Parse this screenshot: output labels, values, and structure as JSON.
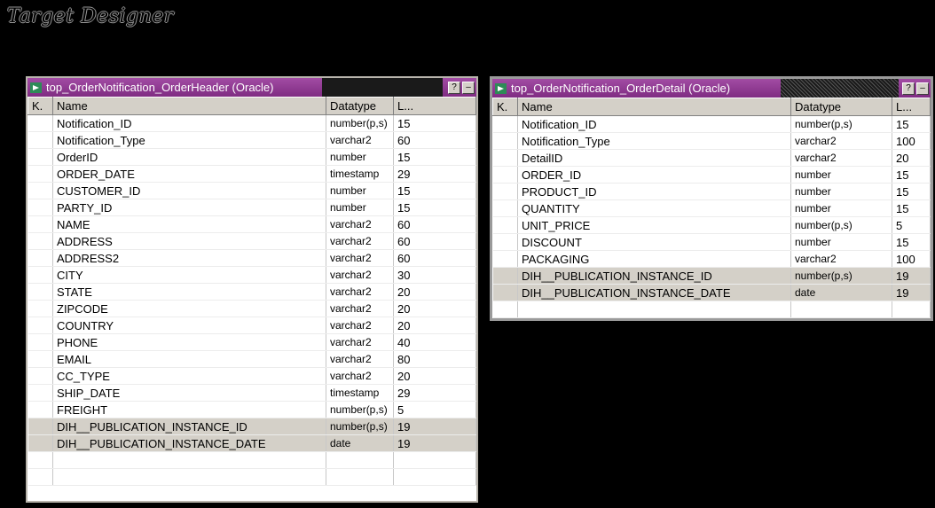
{
  "app": {
    "title": "Target Designer"
  },
  "tables": [
    {
      "title": "top_OrderNotification_OrderHeader (Oracle)",
      "columns": {
        "key": "K.",
        "name": "Name",
        "datatype": "Datatype",
        "length": "L..."
      },
      "rows": [
        {
          "name": "Notification_ID",
          "datatype": "number(p,s)",
          "length": "15"
        },
        {
          "name": "Notification_Type",
          "datatype": "varchar2",
          "length": "60"
        },
        {
          "name": "OrderID",
          "datatype": "number",
          "length": "15"
        },
        {
          "name": "ORDER_DATE",
          "datatype": "timestamp",
          "length": "29"
        },
        {
          "name": "CUSTOMER_ID",
          "datatype": "number",
          "length": "15"
        },
        {
          "name": "PARTY_ID",
          "datatype": "number",
          "length": "15"
        },
        {
          "name": "NAME",
          "datatype": "varchar2",
          "length": "60"
        },
        {
          "name": "ADDRESS",
          "datatype": "varchar2",
          "length": "60"
        },
        {
          "name": "ADDRESS2",
          "datatype": "varchar2",
          "length": "60"
        },
        {
          "name": "CITY",
          "datatype": "varchar2",
          "length": "30"
        },
        {
          "name": "STATE",
          "datatype": "varchar2",
          "length": "20"
        },
        {
          "name": "ZIPCODE",
          "datatype": "varchar2",
          "length": "20"
        },
        {
          "name": "COUNTRY",
          "datatype": "varchar2",
          "length": "20"
        },
        {
          "name": "PHONE",
          "datatype": "varchar2",
          "length": "40"
        },
        {
          "name": "EMAIL",
          "datatype": "varchar2",
          "length": "80"
        },
        {
          "name": "CC_TYPE",
          "datatype": "varchar2",
          "length": "20"
        },
        {
          "name": "SHIP_DATE",
          "datatype": "timestamp",
          "length": "29"
        },
        {
          "name": "FREIGHT",
          "datatype": "number(p,s)",
          "length": "5"
        },
        {
          "name": "DIH__PUBLICATION_INSTANCE_ID",
          "datatype": "number(p,s)",
          "length": "19",
          "highlight": true
        },
        {
          "name": "DIH__PUBLICATION_INSTANCE_DATE",
          "datatype": "date",
          "length": "19",
          "highlight": true
        }
      ],
      "empty_rows": 2
    },
    {
      "title": "top_OrderNotification_OrderDetail (Oracle)",
      "columns": {
        "key": "K.",
        "name": "Name",
        "datatype": "Datatype",
        "length": "L..."
      },
      "rows": [
        {
          "name": "Notification_ID",
          "datatype": "number(p,s)",
          "length": "15"
        },
        {
          "name": "Notification_Type",
          "datatype": "varchar2",
          "length": "100"
        },
        {
          "name": "DetailID",
          "datatype": "varchar2",
          "length": "20"
        },
        {
          "name": "ORDER_ID",
          "datatype": "number",
          "length": "15"
        },
        {
          "name": "PRODUCT_ID",
          "datatype": "number",
          "length": "15"
        },
        {
          "name": "QUANTITY",
          "datatype": "number",
          "length": "15"
        },
        {
          "name": "UNIT_PRICE",
          "datatype": "number(p,s)",
          "length": "5"
        },
        {
          "name": "DISCOUNT",
          "datatype": "number",
          "length": "15"
        },
        {
          "name": "PACKAGING",
          "datatype": "varchar2",
          "length": "100"
        },
        {
          "name": "DIH__PUBLICATION_INSTANCE_ID",
          "datatype": "number(p,s)",
          "length": "19",
          "highlight": true
        },
        {
          "name": "DIH__PUBLICATION_INSTANCE_DATE",
          "datatype": "date",
          "length": "19",
          "highlight": true
        }
      ],
      "empty_rows": 1
    }
  ],
  "buttons": {
    "help": "?",
    "minimize": "–"
  },
  "colors": {
    "titlebar": "#8e3a91",
    "highlight_row": "#d4d0c8",
    "background": "#000000"
  }
}
